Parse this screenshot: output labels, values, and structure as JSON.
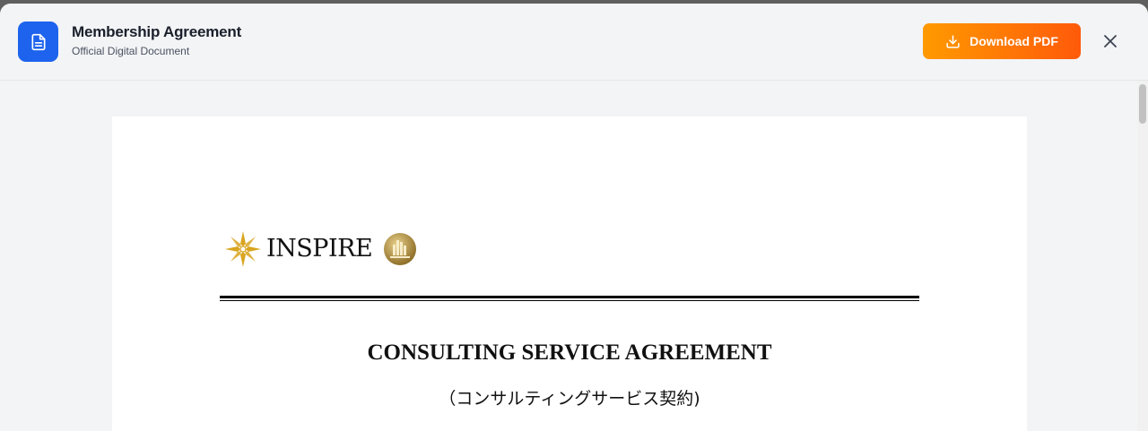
{
  "header": {
    "title": "Membership Agreement",
    "subtitle": "Official Digital Document",
    "download_label": "Download PDF",
    "icons": {
      "document": "document-icon",
      "download": "download-icon",
      "close": "close-icon"
    }
  },
  "document": {
    "logo_text": "INSPIRE",
    "title": "CONSULTING SERVICE AGREEMENT",
    "subtitle": "（コンサルティングサービス契約)"
  },
  "colors": {
    "accent_blue": "#1d63ed",
    "button_gradient_start": "#ff9a00",
    "button_gradient_end": "#ff5a0a",
    "logo_gold": "#d9a520"
  }
}
